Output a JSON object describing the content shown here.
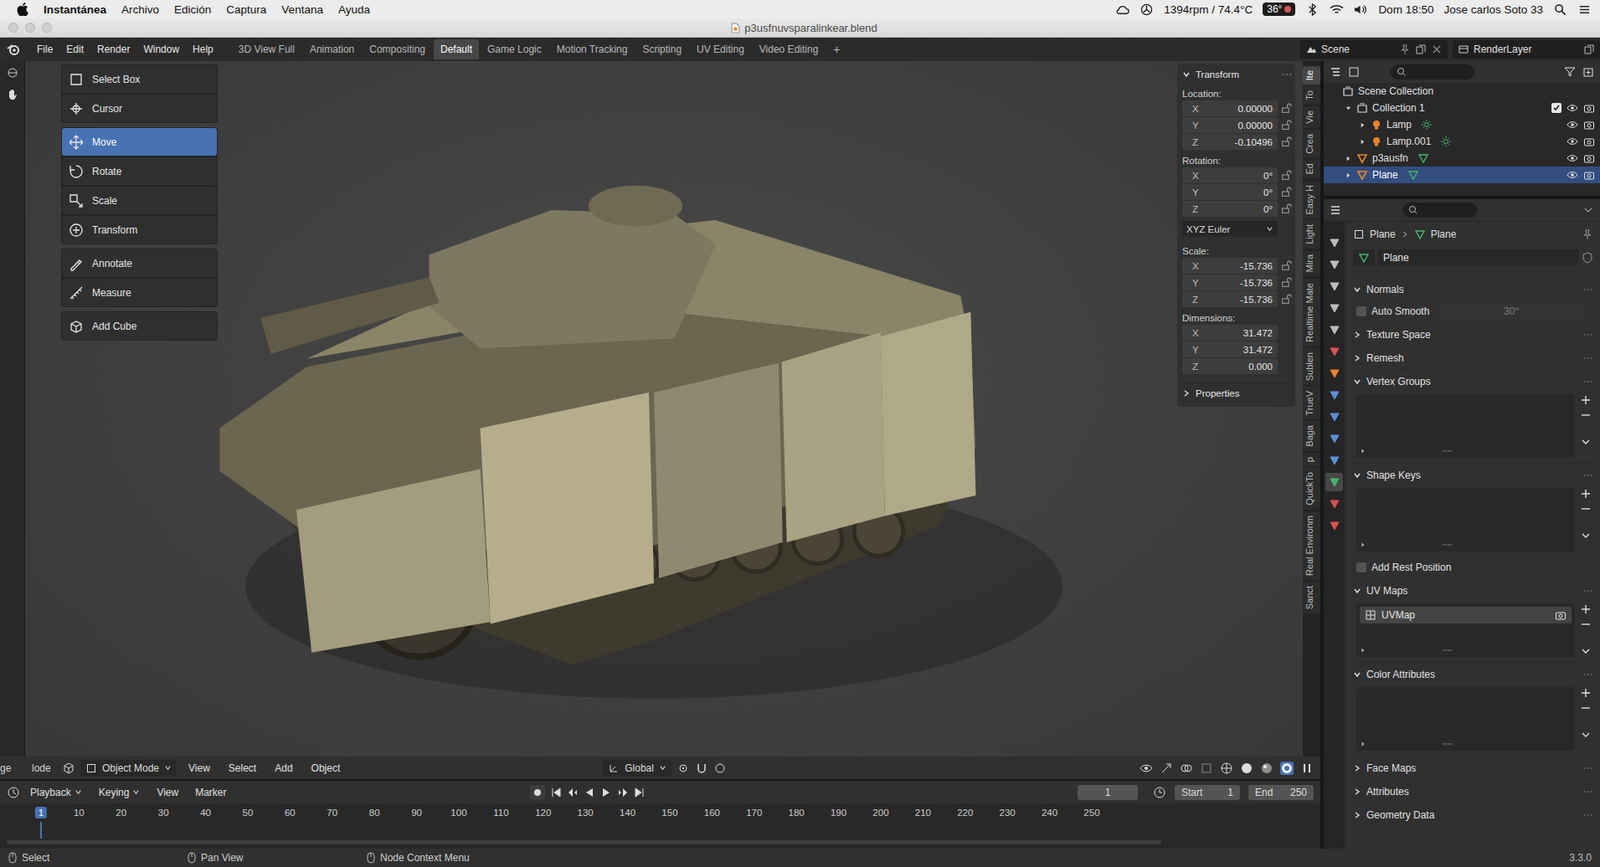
{
  "menubar": {
    "app": "Instantánea",
    "menus": [
      "Archivo",
      "Edición",
      "Captura",
      "Ventana",
      "Ayuda"
    ],
    "fan": "1394rpm / 74.4°C",
    "temperature": "36°",
    "clock": "Dom 18:50",
    "user": "Jose carlos Soto 33"
  },
  "window": {
    "title": "p3usfnuvsparalinkear.blend"
  },
  "topbar": {
    "menus": [
      "File",
      "Edit",
      "Render",
      "Window",
      "Help"
    ],
    "workspaces": [
      {
        "label": "3D View Full",
        "selected": false
      },
      {
        "label": "Animation",
        "selected": false
      },
      {
        "label": "Compositing",
        "selected": false
      },
      {
        "label": "Default",
        "selected": true
      },
      {
        "label": "Game Logic",
        "selected": false
      },
      {
        "label": "Motion Tracking",
        "selected": false
      },
      {
        "label": "Scripting",
        "selected": false
      },
      {
        "label": "UV Editing",
        "selected": false
      },
      {
        "label": "Video Editing",
        "selected": false
      }
    ],
    "add_workspace": "+",
    "scene": "Scene",
    "view_layer": "RenderLayer"
  },
  "tool_groups": [
    {
      "tools": [
        {
          "label": "Select Box",
          "selected": false
        },
        {
          "label": "Cursor",
          "selected": false
        }
      ]
    },
    {
      "tools": [
        {
          "label": "Move",
          "selected": true
        },
        {
          "label": "Rotate",
          "selected": false
        },
        {
          "label": "Scale",
          "selected": false
        },
        {
          "label": "Transform",
          "selected": false
        }
      ]
    },
    {
      "tools": [
        {
          "label": "Annotate",
          "selected": false
        },
        {
          "label": "Measure",
          "selected": false
        }
      ]
    },
    {
      "tools": [
        {
          "label": "Add Cube",
          "selected": false
        }
      ]
    }
  ],
  "transform": {
    "title": "Transform",
    "groups": [
      {
        "label": "Location:",
        "lockable": true,
        "fields": [
          {
            "axis": "X",
            "value": "0.00000",
            "locked": false
          },
          {
            "axis": "Y",
            "value": "0.00000",
            "locked": false
          },
          {
            "axis": "Z",
            "value": "-0.10496",
            "locked": false
          }
        ]
      },
      {
        "label": "Rotation:",
        "lockable": true,
        "fields": [
          {
            "axis": "X",
            "value": "0°",
            "locked": false
          },
          {
            "axis": "Y",
            "value": "0°",
            "locked": false
          },
          {
            "axis": "Z",
            "value": "0°",
            "locked": false
          }
        ],
        "mode": "XYZ Euler"
      },
      {
        "label": "Scale:",
        "lockable": true,
        "fields": [
          {
            "axis": "X",
            "value": "-15.736",
            "locked": false
          },
          {
            "axis": "Y",
            "value": "-15.736",
            "locked": false
          },
          {
            "axis": "Z",
            "value": "-15.736",
            "locked": false
          }
        ]
      },
      {
        "label": "Dimensions:",
        "lockable": false,
        "fields": [
          {
            "axis": "X",
            "value": "31.472",
            "locked": false
          },
          {
            "axis": "Y",
            "value": "31.472",
            "locked": false
          },
          {
            "axis": "Z",
            "value": "0.000",
            "locked": false
          }
        ]
      }
    ],
    "properties": "Properties",
    "expanded": true,
    "properties_expanded": false
  },
  "region_tabs": [
    {
      "label": "Ite",
      "selected": true
    },
    {
      "label": "To",
      "selected": false
    },
    {
      "label": "Vie",
      "selected": false
    },
    {
      "label": "Crea",
      "selected": false
    },
    {
      "label": "Ed",
      "selected": false
    },
    {
      "label": "Easy H",
      "selected": false
    },
    {
      "label": "Light",
      "selected": false
    },
    {
      "label": "Mira",
      "selected": false
    },
    {
      "label": "Realtime Mate",
      "selected": false
    },
    {
      "label": "Sublen",
      "selected": false
    },
    {
      "label": "TrueV",
      "selected": false
    },
    {
      "label": "Baga",
      "selected": false
    },
    {
      "label": "p",
      "selected": false
    },
    {
      "label": "QuickTo",
      "selected": false
    },
    {
      "label": "Real Environm",
      "selected": false
    },
    {
      "label": "Sanct",
      "selected": false
    }
  ],
  "viewport_header": {
    "cut_labels": [
      "ge",
      "lode"
    ],
    "mode": "Object Mode",
    "menus": [
      "View",
      "Select",
      "Add",
      "Object"
    ],
    "orientation": "Global"
  },
  "timeline": {
    "menus": [
      {
        "label": "Playback",
        "dropdown": true
      },
      {
        "label": "Keying",
        "dropdown": true
      },
      {
        "label": "View",
        "dropdown": false
      },
      {
        "label": "Marker",
        "dropdown": false
      }
    ],
    "current_frame": "1",
    "start_label": "Start",
    "start": "1",
    "end_label": "End",
    "end": "250",
    "ticks": [
      "1",
      "10",
      "20",
      "30",
      "40",
      "50",
      "60",
      "70",
      "80",
      "90",
      "100",
      "110",
      "120",
      "130",
      "140",
      "150",
      "160",
      "170",
      "180",
      "190",
      "200",
      "210",
      "220",
      "230",
      "240",
      "250"
    ]
  },
  "status_bar": {
    "items": [
      "Select",
      "Pan View",
      "Node Context Menu"
    ],
    "version": "3.3.0"
  },
  "outliner": {
    "items": [
      {
        "name": "Scene Collection",
        "kind": "scene",
        "depth": 0,
        "expandable": false,
        "expanded": false,
        "selected": false,
        "visible": true,
        "included": true
      },
      {
        "name": "Collection 1",
        "kind": "collection",
        "depth": 1,
        "expandable": true,
        "expanded": true,
        "selected": false,
        "visible": true,
        "included": true
      },
      {
        "name": "Lamp",
        "kind": "light",
        "depth": 2,
        "expandable": true,
        "expanded": false,
        "selected": false,
        "visible": true,
        "included": true
      },
      {
        "name": "Lamp.001",
        "kind": "light",
        "depth": 2,
        "expandable": true,
        "expanded": false,
        "selected": false,
        "visible": true,
        "included": true
      },
      {
        "name": "p3ausfn",
        "kind": "mesh",
        "depth": 1,
        "expandable": true,
        "expanded": false,
        "selected": false,
        "visible": true,
        "included": true
      },
      {
        "name": "Plane",
        "kind": "mesh",
        "depth": 1,
        "expandable": true,
        "expanded": false,
        "selected": true,
        "visible": true,
        "included": true
      }
    ]
  },
  "properties": {
    "tabs": [
      {
        "color": "#bdbdbd",
        "selected": false
      },
      {
        "color": "#bdbdbd",
        "selected": false
      },
      {
        "color": "#bdbdbd",
        "selected": false
      },
      {
        "color": "#bdbdbd",
        "selected": false
      },
      {
        "color": "#bdbdbd",
        "selected": false
      },
      {
        "color": "#d9534f",
        "selected": false
      },
      {
        "color": "#e8842e",
        "selected": false
      },
      {
        "color": "#5d8fd6",
        "selected": false
      },
      {
        "color": "#5d8fd6",
        "selected": false
      },
      {
        "color": "#5d8fd6",
        "selected": false
      },
      {
        "color": "#5d8fd6",
        "selected": false
      },
      {
        "color": "#45b36b",
        "selected": true
      },
      {
        "color": "#d9534f",
        "selected": false
      },
      {
        "color": "#d9534f",
        "selected": false
      }
    ],
    "breadcrumb": [
      "Plane",
      "Plane"
    ],
    "mesh_name": "Plane",
    "sections": [
      {
        "title": "Normals",
        "expanded": true,
        "kind": "normals",
        "option": {
          "label": "Auto Smooth",
          "checked": false,
          "value": "30°",
          "disabled": true
        },
        "rows": []
      },
      {
        "title": "Texture Space",
        "expanded": false,
        "kind": "plain",
        "rows": []
      },
      {
        "title": "Remesh",
        "expanded": false,
        "kind": "plain",
        "rows": []
      },
      {
        "title": "Vertex Groups",
        "expanded": true,
        "kind": "list",
        "rows": []
      },
      {
        "title": "Shape Keys",
        "expanded": true,
        "kind": "list",
        "rows": [],
        "option": {
          "label": "Add Rest Position",
          "checked": false,
          "value": "",
          "disabled": false
        }
      },
      {
        "title": "UV Maps",
        "expanded": true,
        "kind": "list",
        "rows": [
          {
            "name": "UVMap",
            "selected": true
          }
        ]
      },
      {
        "title": "Color Attributes",
        "expanded": true,
        "kind": "list",
        "rows": []
      },
      {
        "title": "Face Maps",
        "expanded": false,
        "kind": "plain",
        "rows": []
      },
      {
        "title": "Attributes",
        "expanded": false,
        "kind": "plain",
        "rows": []
      },
      {
        "title": "Geometry Data",
        "expanded": false,
        "kind": "plain",
        "rows": []
      }
    ]
  }
}
